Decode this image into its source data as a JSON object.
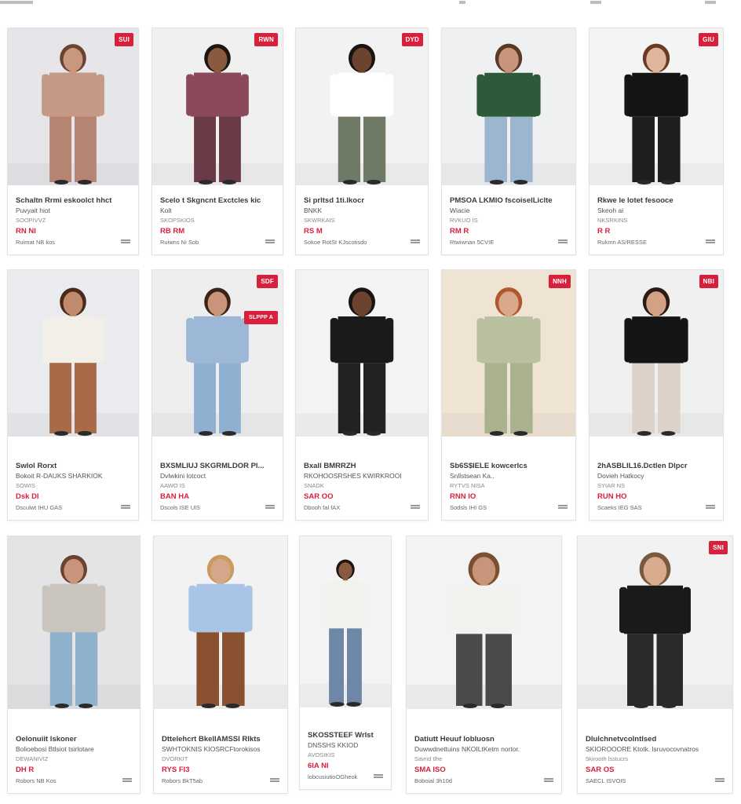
{
  "products": [
    {
      "badge": "SUI",
      "title": "Schaltn Rrmi eskoolct hhct",
      "subtitle": "Puvyait hiot",
      "sku": "SOOPIVVZ",
      "price": "RN Nl",
      "shipping": "Ruimat NB kos",
      "colors": {
        "bg": "#e6e6ea",
        "outfit": "#c49a86",
        "outfit2": "#b58572",
        "skin": "#c9977c",
        "hair": "#6b4330"
      }
    },
    {
      "badge": "RWN",
      "title": "Scelo t Skgncnt Exctcles kic",
      "subtitle": "Kolt",
      "sku": "SKOPSKIOS",
      "price": "RB RM",
      "shipping": "Ruiwns Ni Sob",
      "colors": {
        "bg": "#f0f0f0",
        "outfit": "#8a4a5a",
        "outfit2": "#6b3a47",
        "skin": "#8a5a40",
        "hair": "#1e1410"
      }
    },
    {
      "badge": "DYD",
      "title": "Si prltsd 1ti.lkocr",
      "subtitle": "BNKK",
      "sku": "SKWRKAIS",
      "price": "RS M",
      "shipping": "Sokoe RotSt KJscotisdo",
      "colors": {
        "bg": "#f2f2f2",
        "outfit": "#ffffff",
        "outfit2": "#6f7a66",
        "skin": "#6b4430",
        "hair": "#1a1410"
      }
    },
    {
      "badge": "",
      "title": "PMSOA LKMIO fscoiselLiclte",
      "subtitle": "Wiacie",
      "sku": "RVKUO IS",
      "price": "RM R",
      "shipping": "Rtwiwnan 5CVIE",
      "colors": {
        "bg": "#eef0f2",
        "outfit": "#2f5a3a",
        "outfit2": "#9db6cf",
        "skin": "#c8957a",
        "hair": "#5a3a26"
      }
    },
    {
      "badge": "GIU",
      "title": "Rkwe le lotet fesooce",
      "subtitle": "Skeoh ai",
      "sku": "NKSRKINS",
      "price": "R R",
      "shipping": "Rukmn AS/RESSE",
      "colors": {
        "bg": "#f4f4f4",
        "outfit": "#141414",
        "outfit2": "#1f1f1f",
        "skin": "#e0b69c",
        "hair": "#6a3a22"
      }
    },
    {
      "badge": "",
      "title": "Swlol Rorxt",
      "subtitle": "Bokoit R-DAUKS SHARKIOK",
      "sku": "SOWIS",
      "price": "Dsk Dl",
      "shipping": "Dsculwt IHU GAS",
      "colors": {
        "bg": "#e9ebef",
        "outfit": "#f2efe8",
        "outfit2": "#a86a48",
        "skin": "#c08a6c",
        "hair": "#4a2a1a"
      }
    },
    {
      "badge": "SDF",
      "title": "BXSMLIUJ SKGRMLDOR Pl...",
      "subtitle": "Dvlwkini lotcoct",
      "sku": "AAWO IS",
      "price": "BAN HA",
      "shipping": "Dscols ISE UlS",
      "colors": {
        "bg": "#eeeeee",
        "outfit": "#9db8d6",
        "outfit2": "#8fb0d0",
        "skin": "#c8957a",
        "hair": "#3a2418"
      },
      "promo": "SLPPP A"
    },
    {
      "badge": "",
      "title": "Bxall BMRRZH",
      "subtitle": "RKOHOOSRSHES KWIRKROOI",
      "sku": "SNADK",
      "price": "SAR OO",
      "shipping": "Dbooh fal fAX",
      "colors": {
        "bg": "#f3f3f3",
        "outfit": "#1a1a1a",
        "outfit2": "#222222",
        "skin": "#6b4430",
        "hair": "#1a1410"
      }
    },
    {
      "badge": "NNH",
      "title": "Sb6S$IELE kowcerlcs",
      "subtitle": "Snllstsean Ka..",
      "sku": "RYTVS NISA",
      "price": "RNN IO",
      "shipping": "Sodsls IHI GS",
      "colors": {
        "bg": "#efe4d4",
        "outfit": "#b9c0a0",
        "outfit2": "#aab18f",
        "skin": "#d9a88a",
        "hair": "#b0582e"
      }
    },
    {
      "badge": "NBI",
      "title": "2hASBLIL16.Dctlen Dlpcr",
      "subtitle": "Dovieh Hatkocy",
      "sku": "SYIAR NS",
      "price": "RUN HO",
      "shipping": "Scaeks IEG SAS",
      "colors": {
        "bg": "#f0f0f0",
        "outfit": "#151515",
        "outfit2": "#ddd2c8",
        "skin": "#d3a184",
        "hair": "#2a1c14"
      }
    },
    {
      "badge": "",
      "title": "Oelonuiit lskoner",
      "subtitle": "Bolioebosi Btlsiot tsirlotare",
      "sku": "DEWANIVIZ",
      "price": "DH R",
      "shipping": "Robors NB Kos",
      "colors": {
        "bg": "#e4e4e6",
        "outfit": "#c9c4bc",
        "outfit2": "#8fb1cc",
        "skin": "#c8957a",
        "hair": "#6b4330"
      }
    },
    {
      "badge": "",
      "title": "Dttelehcrt BkellAMSSI Rlkts",
      "subtitle": "SWHTOKNIS KIOSRCFtorokisos",
      "sku": "DVORKIT",
      "price": "RYS FI3",
      "shipping": "Robors BkT5ab",
      "colors": {
        "bg": "#f2f2f2",
        "outfit": "#a8c4e6",
        "outfit2": "#8a5030",
        "skin": "#d4a68a",
        "hair": "#c89c60"
      }
    },
    {
      "badge": "",
      "title": "SKOSSTEEF Wrlst",
      "subtitle": "DNSSHS KKIOD",
      "sku": "AVOSIKIS",
      "price": "6IA NI",
      "shipping": "lobcusiutioOGheok",
      "colors": {
        "bg": "#f4f4f4",
        "outfit": "#f4f2ee",
        "outfit2": "#6f87a6",
        "skin": "#8a5a40",
        "hair": "#1e1410"
      }
    },
    {
      "badge": "",
      "title": "Datiutt Heuuf lobluosn",
      "subtitle": "Duwwdnettuins NKOILtKetm nortor.",
      "sku": "Savrid tlhe",
      "price": "SMA ISO",
      "shipping": "Boboial 3h10d",
      "colors": {
        "bg": "#f3f3f3",
        "outfit": "#f4f2ee",
        "outfit2": "#4a4a4a",
        "skin": "#c8957a",
        "hair": "#7a5030"
      }
    },
    {
      "badge": "SNI",
      "title": "Dlulchnetvcolntlsed",
      "subtitle": "SKIOROOORE Ktotk. lsruvocovnatros",
      "sku": "5kirooth lsstucrs",
      "price": "SAR OS",
      "shipping": "SAECL ISVOIS",
      "colors": {
        "bg": "#f2f2f2",
        "outfit": "#1a1a1a",
        "outfit2": "#2a2a2a",
        "skin": "#d9ac8e",
        "hair": "#7a5a3e"
      }
    }
  ]
}
